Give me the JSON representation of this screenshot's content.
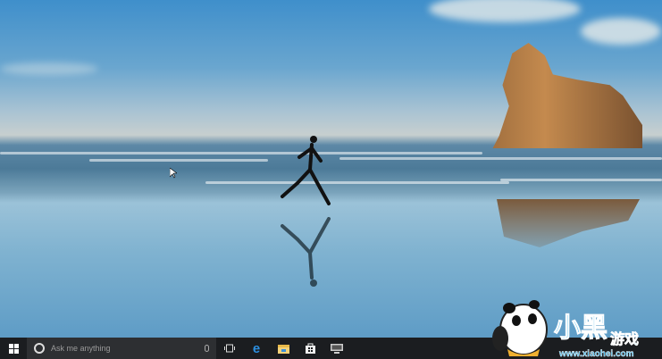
{
  "taskbar": {
    "search_placeholder": "Ask me anything",
    "icons": [
      "windows-start-icon",
      "cortana-icon",
      "microphone-icon",
      "task-view-icon",
      "edge-icon",
      "file-explorer-icon",
      "store-icon",
      "app-icon"
    ]
  },
  "watermark": {
    "text": "小黑游戏",
    "url": "www.xiaohei.com"
  },
  "colors": {
    "taskbar": "#1b1d20",
    "search": "#2d2f32",
    "edge": "#2c8fe0"
  }
}
